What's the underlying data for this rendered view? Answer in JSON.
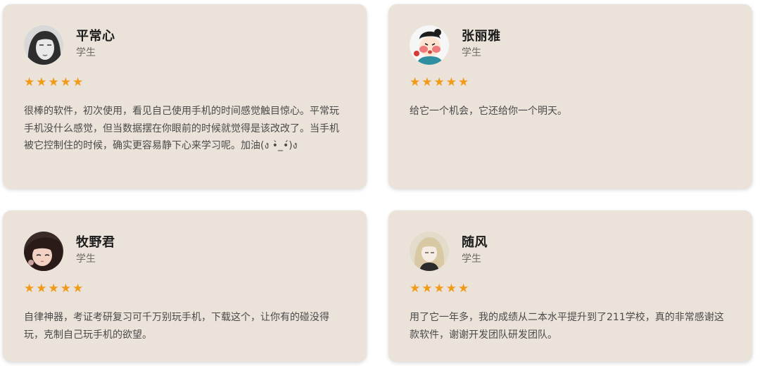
{
  "reviews": [
    {
      "name": "平常心",
      "role": "学生",
      "rating": 5,
      "comment": "很棒的软件，初次使用，看见自己使用手机的时间感觉触目惊心。平常玩手机没什么感觉，但当数据摆在你眼前的时候就觉得是该改改了。当手机被它控制住的时候，确实更容易静下心来学习呢。加油(ง •̀_•́)ง",
      "avatar_icon": "sketch-woman-avatar"
    },
    {
      "name": "张丽雅",
      "role": "学生",
      "rating": 5,
      "comment": "给它一个机会，它还给你一个明天。",
      "avatar_icon": "cartoon-girl-avatar"
    },
    {
      "name": "牧野君",
      "role": "学生",
      "rating": 5,
      "comment": "自律神器，考证考研复习可千万别玩手机，下载这个，让你有的碰没得玩，克制自己玩手机的欲望。",
      "avatar_icon": "anime-girl-avatar"
    },
    {
      "name": "随风",
      "role": "学生",
      "rating": 5,
      "comment": "用了它一年多，我的成绩从二本水平提升到了211学校，真的非常感谢这款软件，谢谢开发团队研发团队。",
      "avatar_icon": "blonde-girl-avatar"
    }
  ],
  "colors": {
    "card_bg": "#ebe3d9",
    "star": "#f09a1a",
    "name": "#1c1c1c",
    "role": "#6d6a66",
    "text": "#4a4a4a"
  }
}
